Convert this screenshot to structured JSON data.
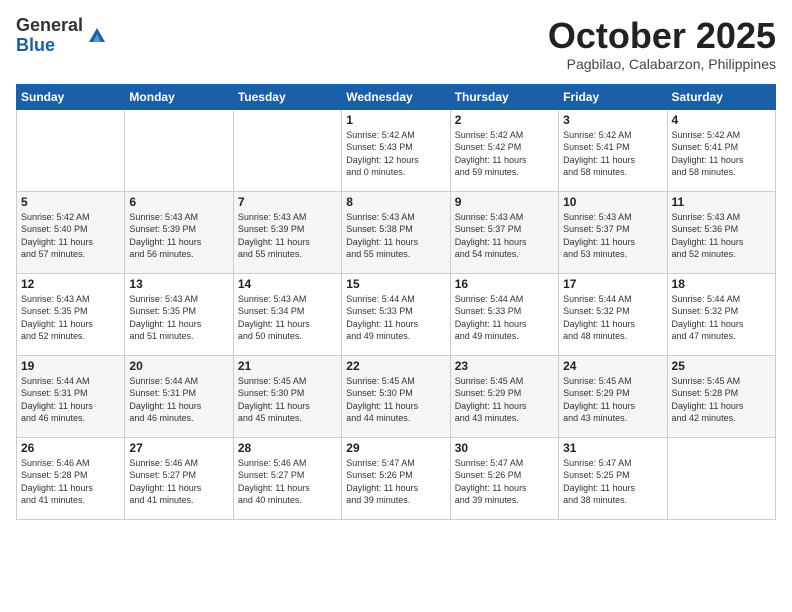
{
  "header": {
    "logo_general": "General",
    "logo_blue": "Blue",
    "month": "October 2025",
    "location": "Pagbilao, Calabarzon, Philippines"
  },
  "days_of_week": [
    "Sunday",
    "Monday",
    "Tuesday",
    "Wednesday",
    "Thursday",
    "Friday",
    "Saturday"
  ],
  "weeks": [
    [
      {
        "day": "",
        "info": ""
      },
      {
        "day": "",
        "info": ""
      },
      {
        "day": "",
        "info": ""
      },
      {
        "day": "1",
        "info": "Sunrise: 5:42 AM\nSunset: 5:43 PM\nDaylight: 12 hours\nand 0 minutes."
      },
      {
        "day": "2",
        "info": "Sunrise: 5:42 AM\nSunset: 5:42 PM\nDaylight: 11 hours\nand 59 minutes."
      },
      {
        "day": "3",
        "info": "Sunrise: 5:42 AM\nSunset: 5:41 PM\nDaylight: 11 hours\nand 58 minutes."
      },
      {
        "day": "4",
        "info": "Sunrise: 5:42 AM\nSunset: 5:41 PM\nDaylight: 11 hours\nand 58 minutes."
      }
    ],
    [
      {
        "day": "5",
        "info": "Sunrise: 5:42 AM\nSunset: 5:40 PM\nDaylight: 11 hours\nand 57 minutes."
      },
      {
        "day": "6",
        "info": "Sunrise: 5:43 AM\nSunset: 5:39 PM\nDaylight: 11 hours\nand 56 minutes."
      },
      {
        "day": "7",
        "info": "Sunrise: 5:43 AM\nSunset: 5:39 PM\nDaylight: 11 hours\nand 55 minutes."
      },
      {
        "day": "8",
        "info": "Sunrise: 5:43 AM\nSunset: 5:38 PM\nDaylight: 11 hours\nand 55 minutes."
      },
      {
        "day": "9",
        "info": "Sunrise: 5:43 AM\nSunset: 5:37 PM\nDaylight: 11 hours\nand 54 minutes."
      },
      {
        "day": "10",
        "info": "Sunrise: 5:43 AM\nSunset: 5:37 PM\nDaylight: 11 hours\nand 53 minutes."
      },
      {
        "day": "11",
        "info": "Sunrise: 5:43 AM\nSunset: 5:36 PM\nDaylight: 11 hours\nand 52 minutes."
      }
    ],
    [
      {
        "day": "12",
        "info": "Sunrise: 5:43 AM\nSunset: 5:35 PM\nDaylight: 11 hours\nand 52 minutes."
      },
      {
        "day": "13",
        "info": "Sunrise: 5:43 AM\nSunset: 5:35 PM\nDaylight: 11 hours\nand 51 minutes."
      },
      {
        "day": "14",
        "info": "Sunrise: 5:43 AM\nSunset: 5:34 PM\nDaylight: 11 hours\nand 50 minutes."
      },
      {
        "day": "15",
        "info": "Sunrise: 5:44 AM\nSunset: 5:33 PM\nDaylight: 11 hours\nand 49 minutes."
      },
      {
        "day": "16",
        "info": "Sunrise: 5:44 AM\nSunset: 5:33 PM\nDaylight: 11 hours\nand 49 minutes."
      },
      {
        "day": "17",
        "info": "Sunrise: 5:44 AM\nSunset: 5:32 PM\nDaylight: 11 hours\nand 48 minutes."
      },
      {
        "day": "18",
        "info": "Sunrise: 5:44 AM\nSunset: 5:32 PM\nDaylight: 11 hours\nand 47 minutes."
      }
    ],
    [
      {
        "day": "19",
        "info": "Sunrise: 5:44 AM\nSunset: 5:31 PM\nDaylight: 11 hours\nand 46 minutes."
      },
      {
        "day": "20",
        "info": "Sunrise: 5:44 AM\nSunset: 5:31 PM\nDaylight: 11 hours\nand 46 minutes."
      },
      {
        "day": "21",
        "info": "Sunrise: 5:45 AM\nSunset: 5:30 PM\nDaylight: 11 hours\nand 45 minutes."
      },
      {
        "day": "22",
        "info": "Sunrise: 5:45 AM\nSunset: 5:30 PM\nDaylight: 11 hours\nand 44 minutes."
      },
      {
        "day": "23",
        "info": "Sunrise: 5:45 AM\nSunset: 5:29 PM\nDaylight: 11 hours\nand 43 minutes."
      },
      {
        "day": "24",
        "info": "Sunrise: 5:45 AM\nSunset: 5:29 PM\nDaylight: 11 hours\nand 43 minutes."
      },
      {
        "day": "25",
        "info": "Sunrise: 5:45 AM\nSunset: 5:28 PM\nDaylight: 11 hours\nand 42 minutes."
      }
    ],
    [
      {
        "day": "26",
        "info": "Sunrise: 5:46 AM\nSunset: 5:28 PM\nDaylight: 11 hours\nand 41 minutes."
      },
      {
        "day": "27",
        "info": "Sunrise: 5:46 AM\nSunset: 5:27 PM\nDaylight: 11 hours\nand 41 minutes."
      },
      {
        "day": "28",
        "info": "Sunrise: 5:46 AM\nSunset: 5:27 PM\nDaylight: 11 hours\nand 40 minutes."
      },
      {
        "day": "29",
        "info": "Sunrise: 5:47 AM\nSunset: 5:26 PM\nDaylight: 11 hours\nand 39 minutes."
      },
      {
        "day": "30",
        "info": "Sunrise: 5:47 AM\nSunset: 5:26 PM\nDaylight: 11 hours\nand 39 minutes."
      },
      {
        "day": "31",
        "info": "Sunrise: 5:47 AM\nSunset: 5:25 PM\nDaylight: 11 hours\nand 38 minutes."
      },
      {
        "day": "",
        "info": ""
      }
    ]
  ]
}
